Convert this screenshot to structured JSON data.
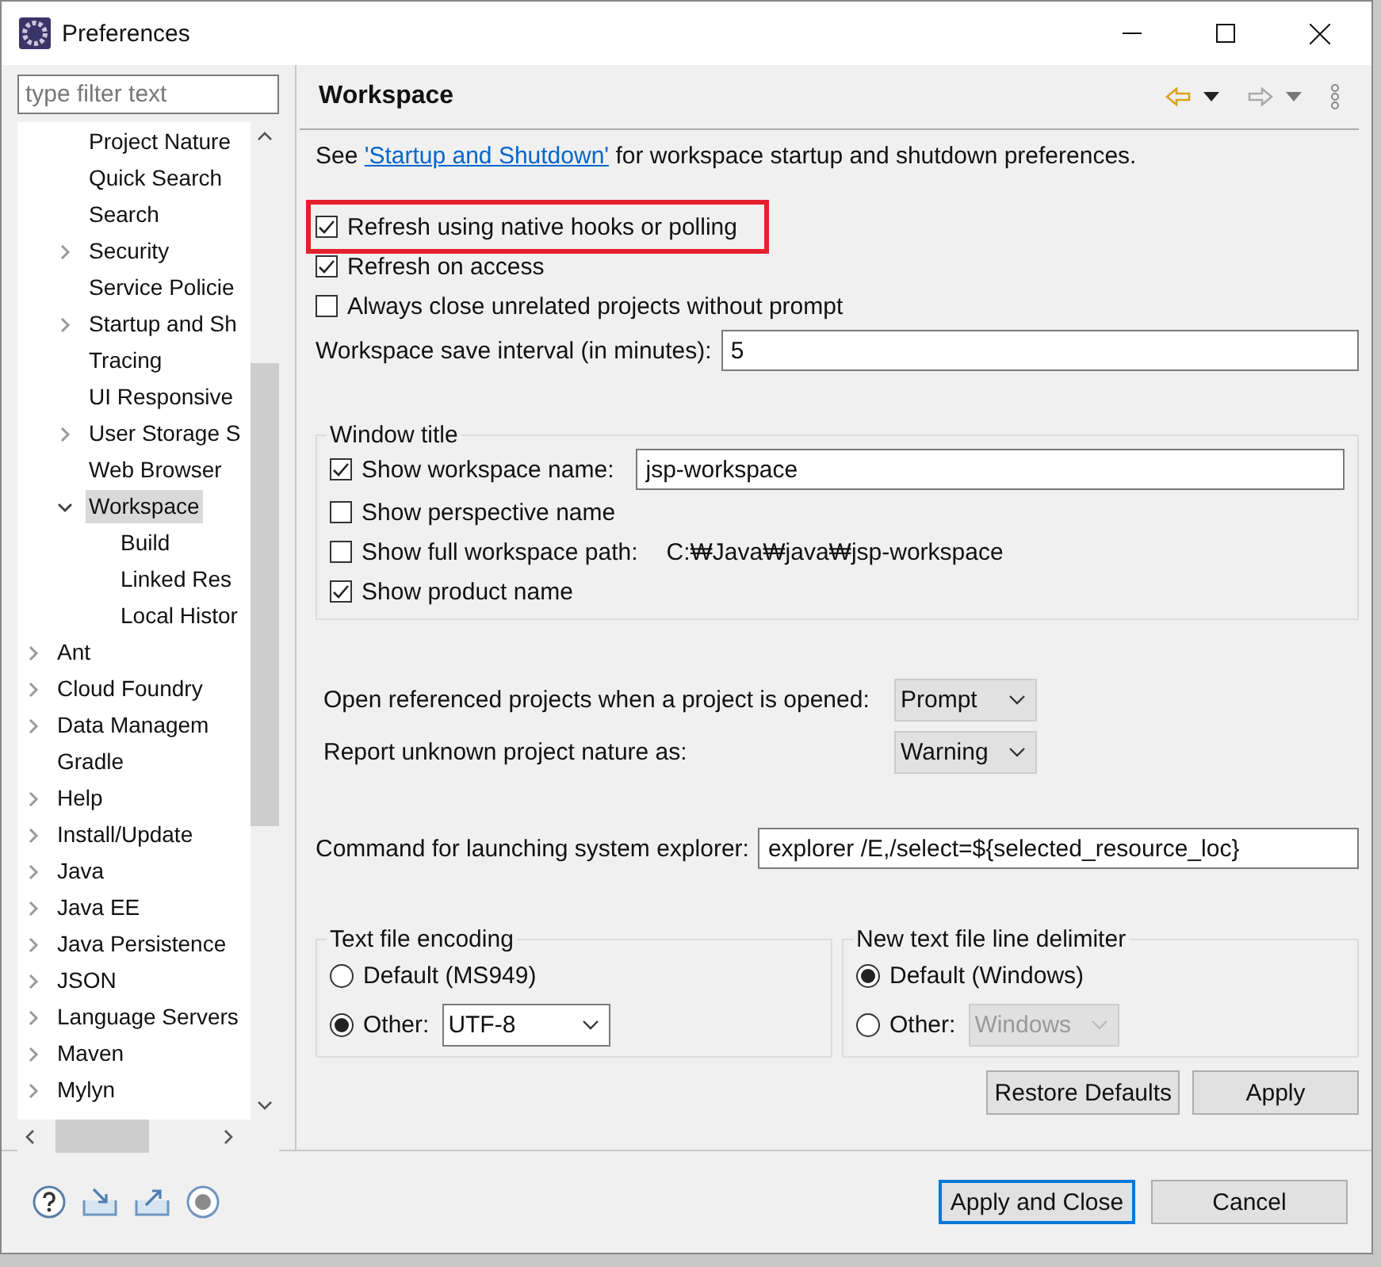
{
  "window": {
    "title": "Preferences"
  },
  "filter": {
    "placeholder": "type filter text"
  },
  "tree": [
    {
      "children": [
        {
          "label": "Project Nature",
          "selected": false
        },
        {
          "label": "Quick Search",
          "selected": false
        },
        {
          "label": "Search",
          "selected": false
        },
        {
          "label": "Security",
          "selected": false,
          "expanded": false
        },
        {
          "label": "Service Policie",
          "selected": false
        },
        {
          "label": "Startup and Sh",
          "selected": false,
          "expanded": false
        },
        {
          "label": "Tracing",
          "selected": false
        },
        {
          "label": "UI Responsive",
          "selected": false
        },
        {
          "label": "User Storage S",
          "selected": false,
          "expanded": false
        },
        {
          "label": "Web Browser",
          "selected": false
        },
        {
          "label": "Workspace",
          "selected": true,
          "expanded": true,
          "children": [
            {
              "label": "Build",
              "selected": false
            },
            {
              "label": "Linked Res",
              "selected": false
            },
            {
              "label": "Local Histor",
              "selected": false
            }
          ]
        }
      ]
    },
    {
      "label": "Ant",
      "selected": false,
      "expanded": false
    },
    {
      "label": "Cloud Foundry",
      "selected": false,
      "expanded": false
    },
    {
      "label": "Data Managem",
      "selected": false,
      "expanded": false
    },
    {
      "label": "Gradle",
      "selected": false
    },
    {
      "label": "Help",
      "selected": false,
      "expanded": false
    },
    {
      "label": "Install/Update",
      "selected": false,
      "expanded": false
    },
    {
      "label": "Java",
      "selected": false,
      "expanded": false
    },
    {
      "label": "Java EE",
      "selected": false,
      "expanded": false
    },
    {
      "label": "Java Persistence",
      "selected": false,
      "expanded": false
    },
    {
      "label": "JSON",
      "selected": false,
      "expanded": false
    },
    {
      "label": "Language Servers",
      "selected": false,
      "expanded": false
    },
    {
      "label": "Maven",
      "selected": false,
      "expanded": false
    },
    {
      "label": "Mylyn",
      "selected": false,
      "expanded": false
    }
  ],
  "page": {
    "title": "Workspace",
    "intro": {
      "before": "See ",
      "link": "'Startup and Shutdown'",
      "after": " for workspace startup and shutdown preferences."
    },
    "options": [
      {
        "label": "Refresh using native hooks or polling",
        "checked": true,
        "highlighted": true
      },
      {
        "label": "Refresh on access",
        "checked": true,
        "highlighted": false
      },
      {
        "label": "Always close unrelated projects without prompt",
        "checked": false,
        "highlighted": false
      }
    ],
    "save_interval": {
      "label": "Workspace save interval (in minutes):",
      "value": "5"
    },
    "window_title": {
      "heading": "Window title",
      "options": [
        {
          "kind": "field",
          "label": "Show workspace name:",
          "checked": true,
          "value": "jsp-workspace"
        },
        {
          "kind": "plain",
          "label": "Show perspective name",
          "checked": false
        },
        {
          "kind": "path",
          "label": "Show full workspace path:",
          "checked": false,
          "value": "C:₩Java₩java₩jsp-workspace"
        },
        {
          "kind": "plain",
          "label": "Show product name",
          "checked": true
        }
      ]
    },
    "dropdowns": [
      {
        "label": "Open referenced projects when a project is opened:",
        "value": "Prompt"
      },
      {
        "label": "Report unknown project nature as:",
        "value": "Warning"
      }
    ],
    "explorer": {
      "label": "Command for launching system explorer:",
      "value": "explorer /E,/select=${selected_resource_loc}"
    },
    "groups": [
      {
        "heading": "Text file encoding",
        "options": [
          {
            "label": "Default (MS949)",
            "selected": false
          },
          {
            "label": "Other:",
            "selected": true,
            "value": "UTF-8",
            "disabled": false
          }
        ]
      },
      {
        "heading": "New text file line delimiter",
        "options": [
          {
            "label": "Default (Windows)",
            "selected": true
          },
          {
            "label": "Other:",
            "selected": false,
            "value": "Windows",
            "disabled": true
          }
        ]
      }
    ],
    "page_buttons": [
      "Restore Defaults",
      "Apply"
    ]
  },
  "dialog_buttons": [
    {
      "label": "Apply and Close",
      "default": true
    },
    {
      "label": "Cancel",
      "default": false
    }
  ]
}
